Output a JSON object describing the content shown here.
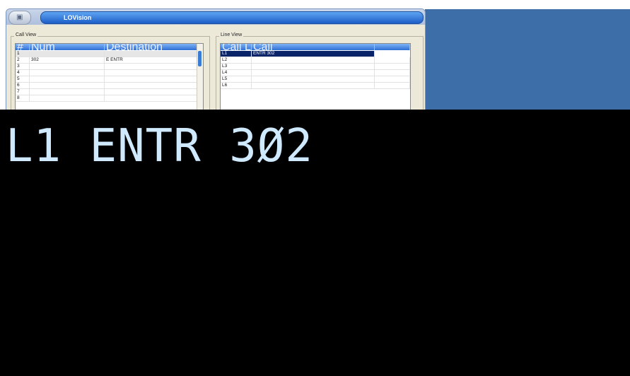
{
  "window": {
    "title": "LOVision",
    "system_icon": "window-icon"
  },
  "call_view": {
    "label": "Call View",
    "columns": [
      "#",
      "Num",
      "Destination"
    ],
    "rows": [
      [
        "1",
        "",
        ""
      ],
      [
        "2",
        "302",
        "E ENTR"
      ],
      [
        "3",
        "",
        ""
      ],
      [
        "4",
        "",
        ""
      ],
      [
        "5",
        "",
        ""
      ],
      [
        "6",
        "",
        ""
      ],
      [
        "7",
        "",
        ""
      ],
      [
        "8",
        "",
        ""
      ]
    ]
  },
  "line_view": {
    "label": "Line View",
    "columns": [
      "Call Line",
      "Call",
      ""
    ],
    "rows": [
      [
        "L1",
        "ENTR 302",
        ""
      ],
      [
        "L2",
        "",
        ""
      ],
      [
        "L3",
        "",
        ""
      ],
      [
        "L4",
        "",
        ""
      ],
      [
        "L5",
        "",
        ""
      ],
      [
        "L6",
        "",
        ""
      ]
    ],
    "selected_row": 0
  },
  "display": {
    "text": "L1 ENTR 3Ø2"
  }
}
